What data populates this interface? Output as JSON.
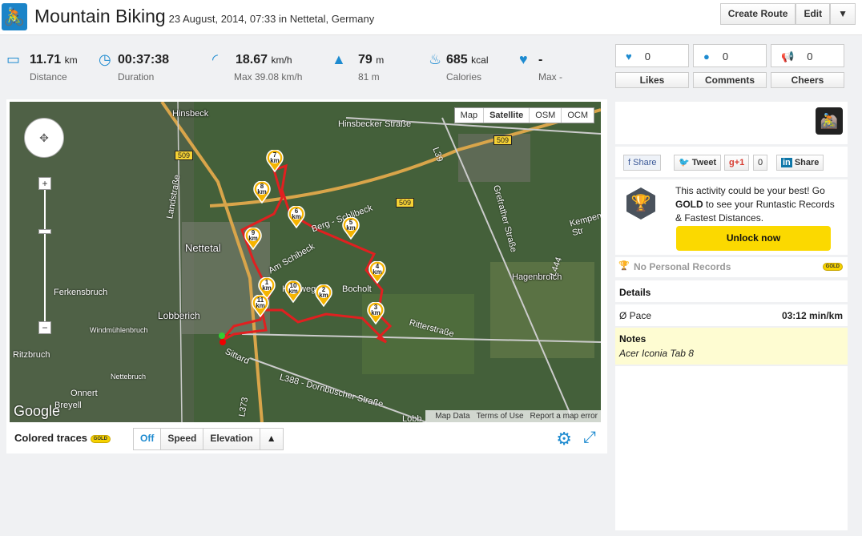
{
  "header": {
    "title": "Mountain Biking",
    "subtitle": "23 August, 2014, 07:33 in Nettetal, Germany",
    "buttons": [
      "Create Route",
      "Edit",
      "▼"
    ],
    "logo_icon": "bike-icon"
  },
  "stats": [
    {
      "icon": "ruler-icon",
      "value": "11.71",
      "unit": "km",
      "label": "Distance"
    },
    {
      "icon": "clock-icon",
      "value": "00:37:38",
      "unit": "",
      "label": "Duration"
    },
    {
      "icon": "speedometer-icon",
      "value": "18.67",
      "unit": "km/h",
      "label": "Max 39.08 km/h"
    },
    {
      "icon": "mountain-icon",
      "value": "79",
      "unit": "m",
      "label": "81 m"
    },
    {
      "icon": "flame-icon",
      "value": "685",
      "unit": "kcal",
      "label": "Calories"
    },
    {
      "icon": "heart-rate-icon",
      "value": "-",
      "unit": "",
      "label": "Max -"
    }
  ],
  "social": [
    {
      "icon": "heart-icon",
      "count": "0",
      "label": "Likes"
    },
    {
      "icon": "comment-icon",
      "count": "0",
      "label": "Comments"
    },
    {
      "icon": "megaphone-icon",
      "count": "0",
      "label": "Cheers"
    }
  ],
  "map": {
    "types": [
      "Map",
      "Satellite",
      "OSM",
      "OCM"
    ],
    "selected": "Satellite",
    "towns": [
      "Hinsbeck",
      "Nettetal",
      "Lobberich",
      "Hagenbroich",
      "Ferkensbruch",
      "Windmühlenbruch",
      "Ritzbruch",
      "Onnert",
      "Nettebruch",
      "Breyell"
    ],
    "roads": [
      "Hinsbecker Straße",
      "Landstraße",
      "Am Schibeck",
      "Berg - Schlibeck",
      "Kastweg",
      "Bocholt",
      "Ritterstraße",
      "Sittard",
      "L388 - Dornbuscher Straße",
      "Grefrather Straße",
      "L39",
      "L444",
      "Kempener Str",
      "L373",
      "Lobb"
    ],
    "signs": [
      "509",
      "509",
      "509"
    ],
    "markers": [
      "1",
      "2",
      "3",
      "4",
      "5",
      "6",
      "7",
      "8",
      "9",
      "10",
      "11"
    ],
    "marker_unit": "km",
    "footer": [
      "Map Data",
      "Terms of Use",
      "Report a map error"
    ],
    "google": "Google",
    "route_color": "#e02020"
  },
  "traces": {
    "label": "Colored traces",
    "badge": "GOLD",
    "options": [
      "Off",
      "Speed",
      "Elevation",
      "▲"
    ],
    "selected": "Off"
  },
  "share": {
    "facebook": "Share",
    "twitter": "Tweet",
    "gplus": "+1",
    "gplus_count": "0",
    "linkedin": "Share"
  },
  "gold": {
    "text_pre": "This activity could be your best! Go ",
    "bold": "GOLD",
    "text_post": " to see your Runtastic Records & Fastest Distances.",
    "button": "Unlock now",
    "accent": "#fbd900"
  },
  "records": {
    "label": "No Personal Records",
    "badge": "GOLD"
  },
  "details": {
    "title": "Details",
    "pace_label": "Ø Pace",
    "pace_value": "03:12 min/km"
  },
  "notes": {
    "title": "Notes",
    "text": "Acer Iconia Tab 8"
  }
}
